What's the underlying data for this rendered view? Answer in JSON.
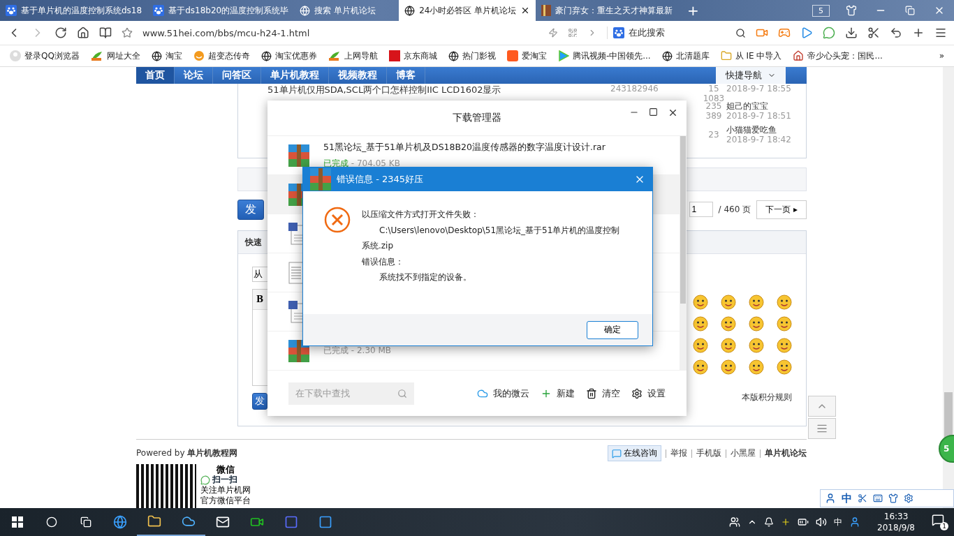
{
  "browser": {
    "tabs": [
      {
        "title": "基于单片机的温度控制系统ds18",
        "selected": false,
        "closable": false
      },
      {
        "title": "基于ds18b20的温度控制系统毕",
        "selected": false,
        "closable": false
      },
      {
        "title": "搜索 单片机论坛",
        "selected": false,
        "closable": false
      },
      {
        "title": "24小时必答区 单片机论坛",
        "selected": true,
        "closable": true
      },
      {
        "title": "豪门弃女：重生之天才神算最新",
        "selected": false,
        "closable": false
      }
    ],
    "new_tab": "+",
    "tab_count": "5",
    "address": "www.51hei.com/bbs/mcu-h24-1.html",
    "search": {
      "placeholder": "在此搜索"
    },
    "bookmarks": [
      {
        "label": "登录QQ浏览器"
      },
      {
        "label": "网址大全"
      },
      {
        "label": "淘宝"
      },
      {
        "label": "超变态传奇"
      },
      {
        "label": "淘宝优惠券"
      },
      {
        "label": "上网导航"
      },
      {
        "label": "京东商城"
      },
      {
        "label": "热门影视"
      },
      {
        "label": "爱淘宝"
      },
      {
        "label": "腾讯视频-中国领先..."
      },
      {
        "label": "北清题库"
      },
      {
        "label": "从 IE 中导入"
      },
      {
        "label": "帝少心头宠：国民..."
      }
    ],
    "more": "»"
  },
  "forum": {
    "nav": [
      {
        "label": "首页",
        "selected": true
      },
      {
        "label": "论坛",
        "selected": false
      },
      {
        "label": "问答区",
        "selected": false
      },
      {
        "label": "单片机教程",
        "selected": false
      },
      {
        "label": "视频教程",
        "selected": false
      },
      {
        "label": "博客",
        "selected": false
      }
    ],
    "quick_nav": "快捷导航",
    "threads": [
      {
        "title": "51单片机仅用SDA,SCL两个口怎样控制IIC LCD1602显示",
        "author": "243182946",
        "replies": "15",
        "views": "1083",
        "last_time": "2018-9-7 18:55"
      },
      {
        "replies": "235",
        "views": "389",
        "last_user": "妲己的宝宝",
        "last_time": "2018-9-7 18:51"
      },
      {
        "views": "23",
        "last_user": "小猫猫爱吃鱼",
        "last_time": "2018-9-7 18:42"
      }
    ],
    "post_button": "发",
    "page_input": "1",
    "page_total": "/ 460 页",
    "next_page": "下一页 ▸",
    "quick_post": {
      "title": "快速",
      "subject_value": "从",
      "bold_button": "B",
      "submit": "发",
      "rules_link": "本版积分规则"
    },
    "footer": {
      "powered_by": "Powered by **单片机教程网**",
      "wechat_title": "微信",
      "scan": "扫一扫",
      "follow": "关注单片机网",
      "platform": "官方微信平台",
      "consult": "在线咨询",
      "links": [
        {
          "label": "举报",
          "strong": false
        },
        {
          "label": "手机版",
          "strong": false
        },
        {
          "label": "小黑屋",
          "strong": false
        },
        {
          "label": "单片机论坛",
          "strong": true
        }
      ]
    },
    "float_badge": "5"
  },
  "download_manager": {
    "title": "下载管理器",
    "items": [
      {
        "kind": "archive",
        "name": "51黑论坛_基于51单片机及DS18B20温度传感器的数字温度计设计.rar",
        "status": "已完成",
        "size": " - 704.05 KB",
        "recent": true,
        "selected": false
      },
      {
        "kind": "archive",
        "selected": true
      },
      {
        "kind": "word",
        "selected": false
      },
      {
        "kind": "text",
        "selected": false
      },
      {
        "kind": "word",
        "selected": false
      },
      {
        "kind": "archive",
        "status": "已完成",
        "size": " - 2.30 MB",
        "recent": false,
        "selected": false
      }
    ],
    "search": {
      "placeholder": "在下载中查找"
    },
    "actions": [
      {
        "label": "我的微云"
      },
      {
        "label": "新建"
      },
      {
        "label": "清空"
      },
      {
        "label": "设置"
      }
    ]
  },
  "error_dialog": {
    "title": "错误信息 - 2345好压",
    "lines": [
      {
        "text": "以压缩文件方式打开文件失败：",
        "indent": false
      },
      {
        "text": "C:\\Users\\lenovo\\Desktop\\51黑论坛_基于51单片机的温度控制",
        "indent": true
      },
      {
        "text": "系统.zip",
        "indent": false
      },
      {
        "text": "错误信息：",
        "indent": false
      },
      {
        "text": "系统找不到指定的设备。",
        "indent": true
      }
    ],
    "ok": "确定"
  },
  "ime_bar": {
    "label": "中"
  },
  "taskbar": {
    "input_method": "中",
    "time": "16:33",
    "date": "2018/9/8",
    "notifications": "1"
  }
}
